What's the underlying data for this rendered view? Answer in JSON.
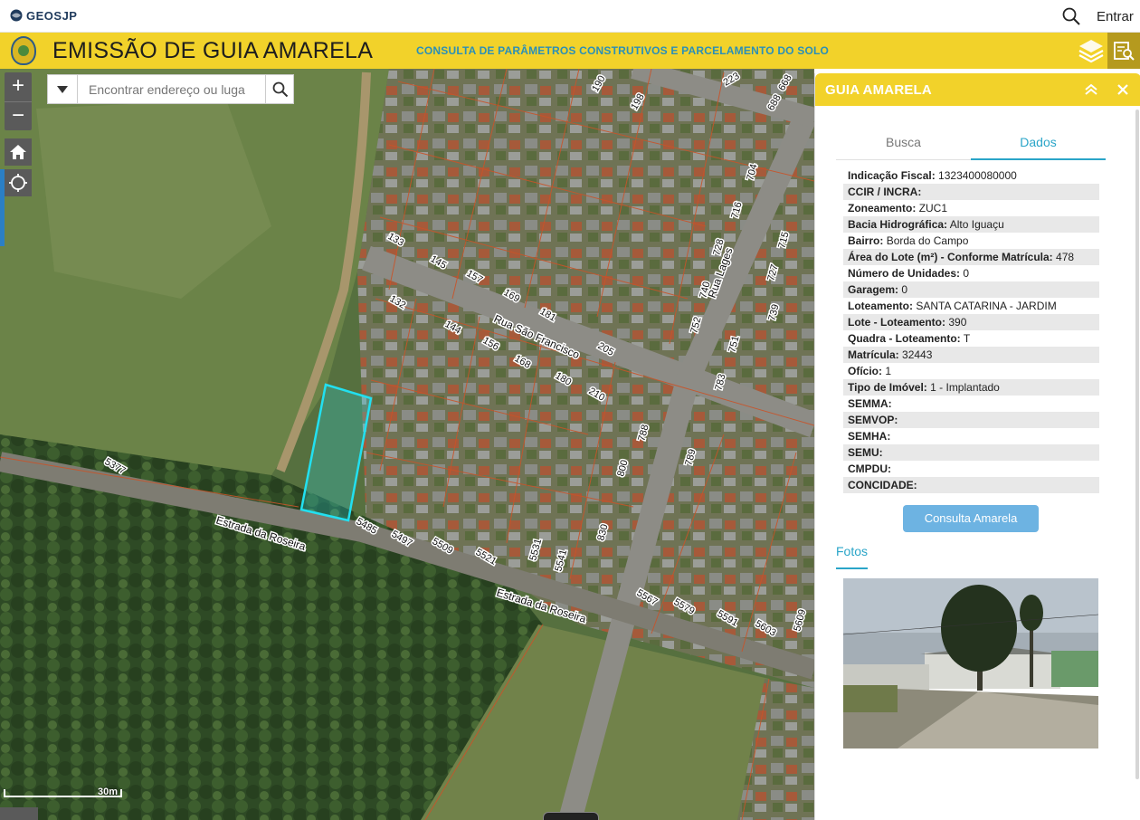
{
  "header": {
    "logo_text": "GEOSJP",
    "login_label": "Entrar"
  },
  "banner": {
    "title": "EMISSÃO DE GUIA AMARELA",
    "subtitle": "CONSULTA DE PARÂMETROS CONSTRUTIVOS E PARCELAMENTO DO SOLO"
  },
  "map": {
    "search_placeholder": "Encontrar endereço ou luga",
    "zoom_in": "+",
    "zoom_out": "−",
    "scale_label": "30m",
    "street_labels": [
      "Rua São Francisco",
      "Estrada da Roseira",
      "Estrada da Roseira",
      "Rua Lages"
    ],
    "lot_numbers": [
      "223",
      "668",
      "688",
      "190",
      "198",
      "704",
      "716",
      "715",
      "133",
      "145",
      "157",
      "169",
      "181",
      "728",
      "740",
      "727",
      "739",
      "751",
      "132",
      "144",
      "156",
      "168",
      "180",
      "205",
      "752",
      "783",
      "210",
      "788",
      "789",
      "800",
      "5377",
      "5485",
      "5497",
      "5509",
      "5521",
      "5531",
      "5541",
      "830",
      "5567",
      "5579",
      "5591",
      "5603",
      "5609"
    ]
  },
  "panel": {
    "title": "GUIA AMARELA",
    "tabs": [
      "Busca",
      "Dados"
    ],
    "active_tab": "Dados",
    "fields": [
      {
        "label": "Indicação Fiscal:",
        "value": "1323400080000"
      },
      {
        "label": "CCIR / INCRA:",
        "value": ""
      },
      {
        "label": "Zoneamento:",
        "value": "ZUC1"
      },
      {
        "label": "Bacia Hidrográfica:",
        "value": "Alto Iguaçu"
      },
      {
        "label": "Bairro:",
        "value": "Borda do Campo"
      },
      {
        "label": "Área do Lote (m²) - Conforme Matrícula:",
        "value": "478"
      },
      {
        "label": "Número de Unidades:",
        "value": "0"
      },
      {
        "label": "Garagem:",
        "value": "0"
      },
      {
        "label": "Loteamento:",
        "value": "SANTA CATARINA - JARDIM"
      },
      {
        "label": "Lote - Loteamento:",
        "value": "390"
      },
      {
        "label": "Quadra - Loteamento:",
        "value": "T"
      },
      {
        "label": "Matrícula:",
        "value": "32443"
      },
      {
        "label": "Ofício:",
        "value": "1"
      },
      {
        "label": "Tipo de Imóvel:",
        "value": "1 - Implantado"
      },
      {
        "label": "SEMMA:",
        "value": ""
      },
      {
        "label": "SEMVOP:",
        "value": ""
      },
      {
        "label": "SEMHA:",
        "value": ""
      },
      {
        "label": "SEMU:",
        "value": ""
      },
      {
        "label": "CMPDU:",
        "value": ""
      },
      {
        "label": "CONCIDADE:",
        "value": ""
      }
    ],
    "consulta_button": "Consulta Amarela",
    "fotos_label": "Fotos"
  },
  "colors": {
    "banner": "#f2d22a",
    "accent": "#2aa5c8",
    "button": "#6db3e2",
    "highlight_lot": "#22e0f0",
    "lot_lines": "#c8542a"
  }
}
